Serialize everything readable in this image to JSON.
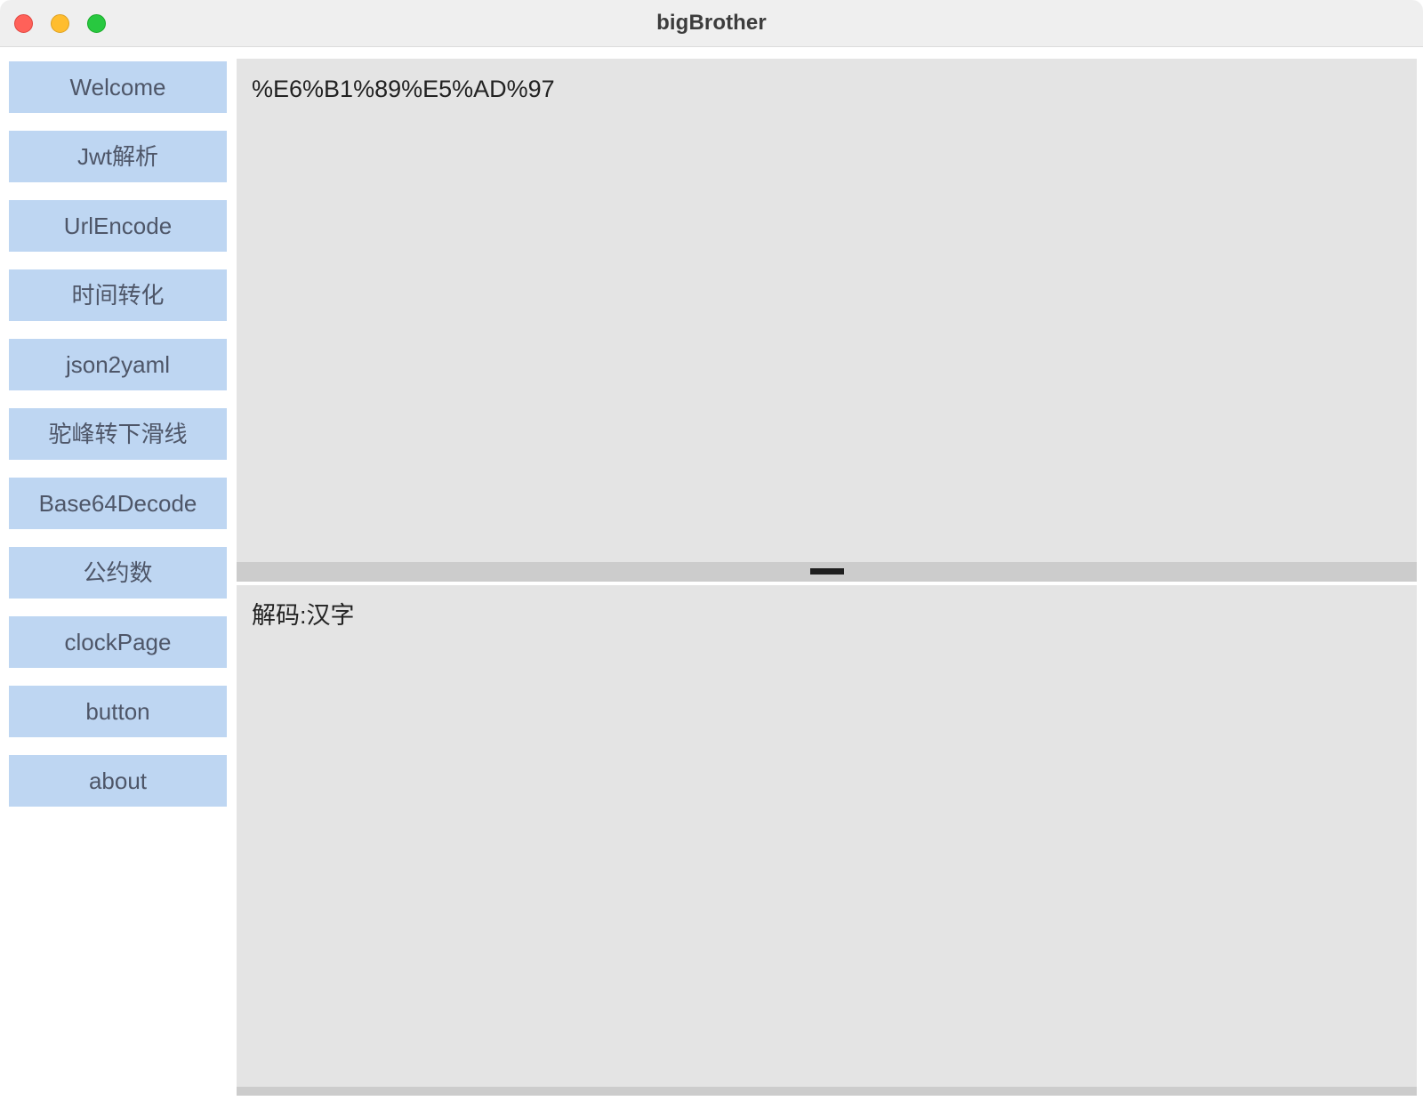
{
  "window": {
    "title": "bigBrother",
    "controls": [
      {
        "name": "close",
        "color": "#ff6159"
      },
      {
        "name": "minimize",
        "color": "#ffbd2e"
      },
      {
        "name": "maximize",
        "color": "#28c840"
      }
    ]
  },
  "sidebar": {
    "items": [
      {
        "label": "Welcome"
      },
      {
        "label": "Jwt解析"
      },
      {
        "label": "UrlEncode"
      },
      {
        "label": "时间转化"
      },
      {
        "label": "json2yaml"
      },
      {
        "label": "驼峰转下滑线"
      },
      {
        "label": "Base64Decode"
      },
      {
        "label": "公约数"
      },
      {
        "label": "clockPage"
      },
      {
        "label": "button"
      },
      {
        "label": "about"
      }
    ],
    "item_bg": "#bed6f2",
    "item_text_color": "#4e5668"
  },
  "main": {
    "input_pane": {
      "value": "%E6%B1%89%E5%AD%97",
      "placeholder": ""
    },
    "output_pane": {
      "value": "解码:汉字",
      "placeholder": ""
    },
    "splitter": {
      "grip": "horizontal-grip"
    },
    "pane_bg": "#e4e4e4",
    "splitter_bg": "#cccccc"
  }
}
